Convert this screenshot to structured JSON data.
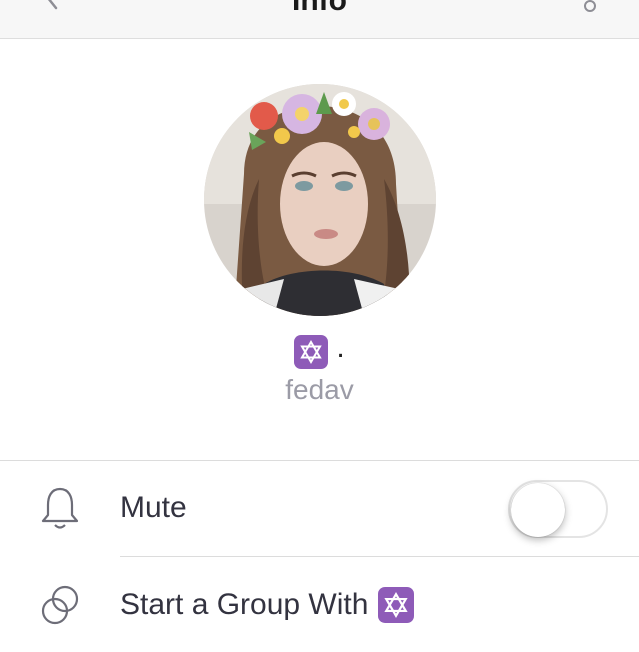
{
  "header": {
    "title": "Info"
  },
  "profile": {
    "name_suffix": ".",
    "username": "fedav",
    "name_emoji": "star-of-david-emoji"
  },
  "options": [
    {
      "icon": "bell-icon",
      "label": "Mute",
      "toggle_on": false
    },
    {
      "icon": "group-circles-icon",
      "label": "Start a Group With",
      "trailing_emoji": "star-of-david-emoji"
    }
  ],
  "colors": {
    "emoji_purple": "#8e5bb8",
    "username_gray": "#9b9ba6",
    "icon_gray": "#6d6d78"
  }
}
